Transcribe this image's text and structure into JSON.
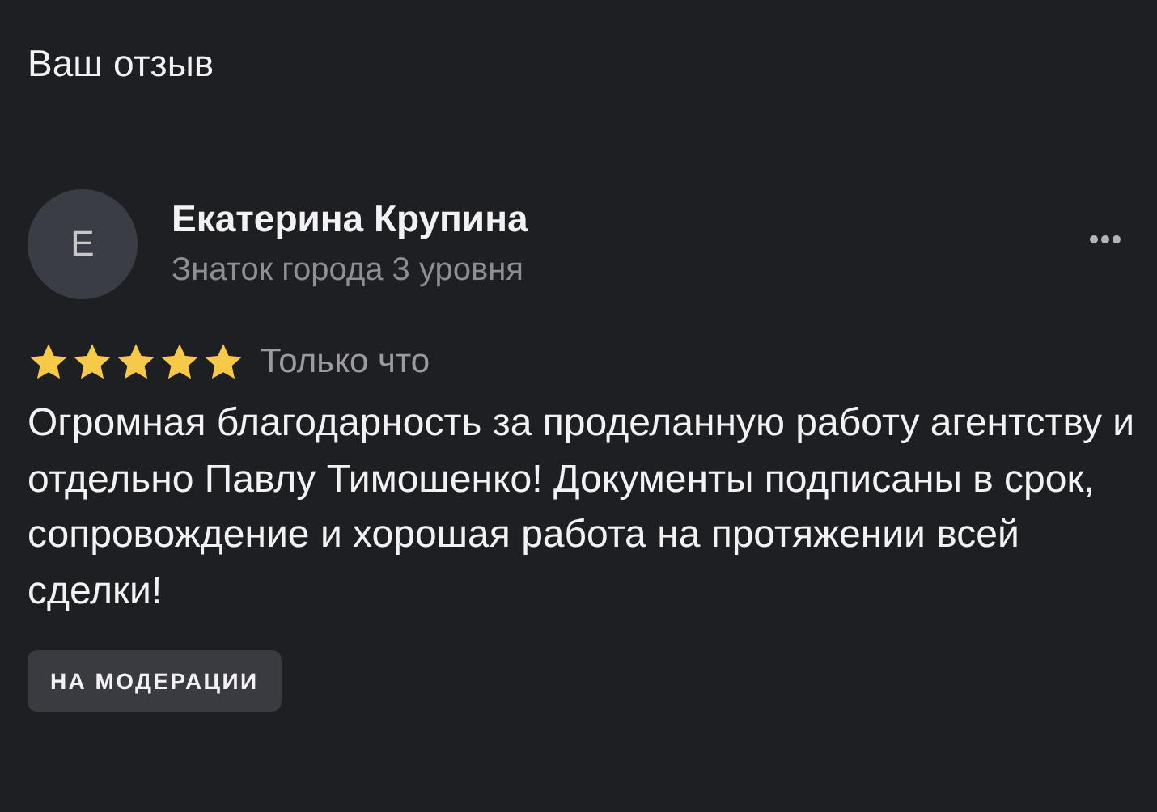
{
  "header": {
    "title": "Ваш отзыв"
  },
  "review": {
    "avatar_letter": "Е",
    "author": "Екатерина Крупина",
    "author_level": "Знаток города 3 уровня",
    "stars": 5,
    "time": "Только что",
    "text": "Огромная благодарность за проделанную работу агентству и отдельно Павлу Тимошенко! Документы подписаны в срок, сопровождение и хорошая работа на протяжении всей сделки!",
    "status": "НА МОДЕРАЦИИ"
  }
}
